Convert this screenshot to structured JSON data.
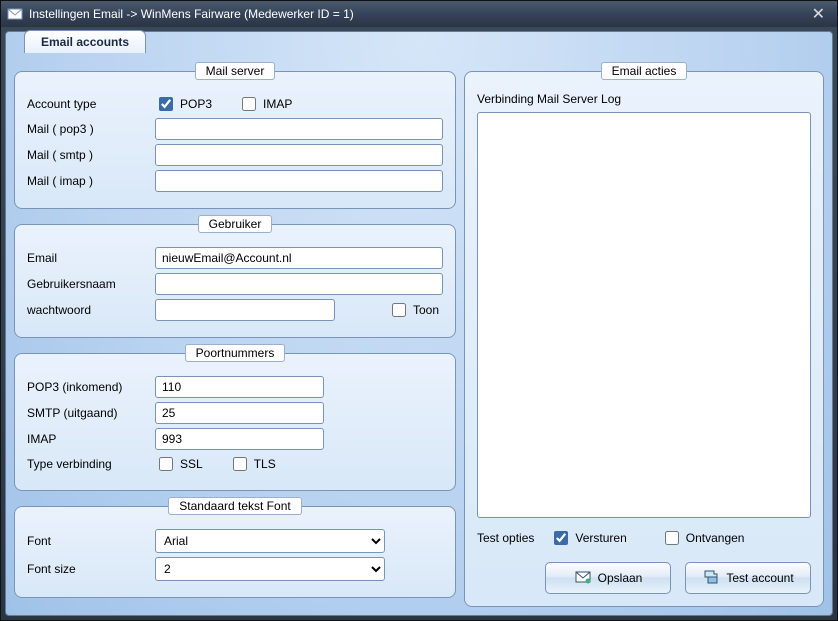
{
  "window": {
    "title": "Instellingen Email -> WinMens Fairware    (Medewerker ID = 1)"
  },
  "tab": {
    "label": "Email accounts"
  },
  "mailserver": {
    "legend": "Mail server",
    "account_type_label": "Account type",
    "pop3_label": "POP3",
    "pop3_checked": true,
    "imap_label": "IMAP",
    "imap_checked": false,
    "mail_pop3_label": "Mail ( pop3 )",
    "mail_pop3_value": "",
    "mail_smtp_label": "Mail ( smtp )",
    "mail_smtp_value": "",
    "mail_imap_label": "Mail ( imap )",
    "mail_imap_value": ""
  },
  "gebruiker": {
    "legend": "Gebruiker",
    "email_label": "Email",
    "email_value": "nieuwEmail@Account.nl",
    "username_label": "Gebruikersnaam",
    "username_value": "",
    "password_label": "wachtwoord",
    "password_value": "",
    "toon_label": "Toon",
    "toon_checked": false
  },
  "poort": {
    "legend": "Poortnummers",
    "pop3_label": "POP3 (inkomend)",
    "pop3_value": "110",
    "smtp_label": "SMTP (uitgaand)",
    "smtp_value": "25",
    "imap_label": "IMAP",
    "imap_value": "993",
    "type_label": "Type verbinding",
    "ssl_label": "SSL",
    "ssl_checked": false,
    "tls_label": "TLS",
    "tls_checked": false
  },
  "font": {
    "legend": "Standaard tekst Font",
    "font_label": "Font",
    "font_value": "Arial",
    "size_label": "Font size",
    "size_value": "2"
  },
  "acties": {
    "legend": "Email acties",
    "log_label": "Verbinding Mail Server Log",
    "test_label": "Test opties",
    "versturen_label": "Versturen",
    "versturen_checked": true,
    "ontvangen_label": "Ontvangen",
    "ontvangen_checked": false,
    "opslaan_label": "Opslaan",
    "test_account_label": "Test account"
  }
}
